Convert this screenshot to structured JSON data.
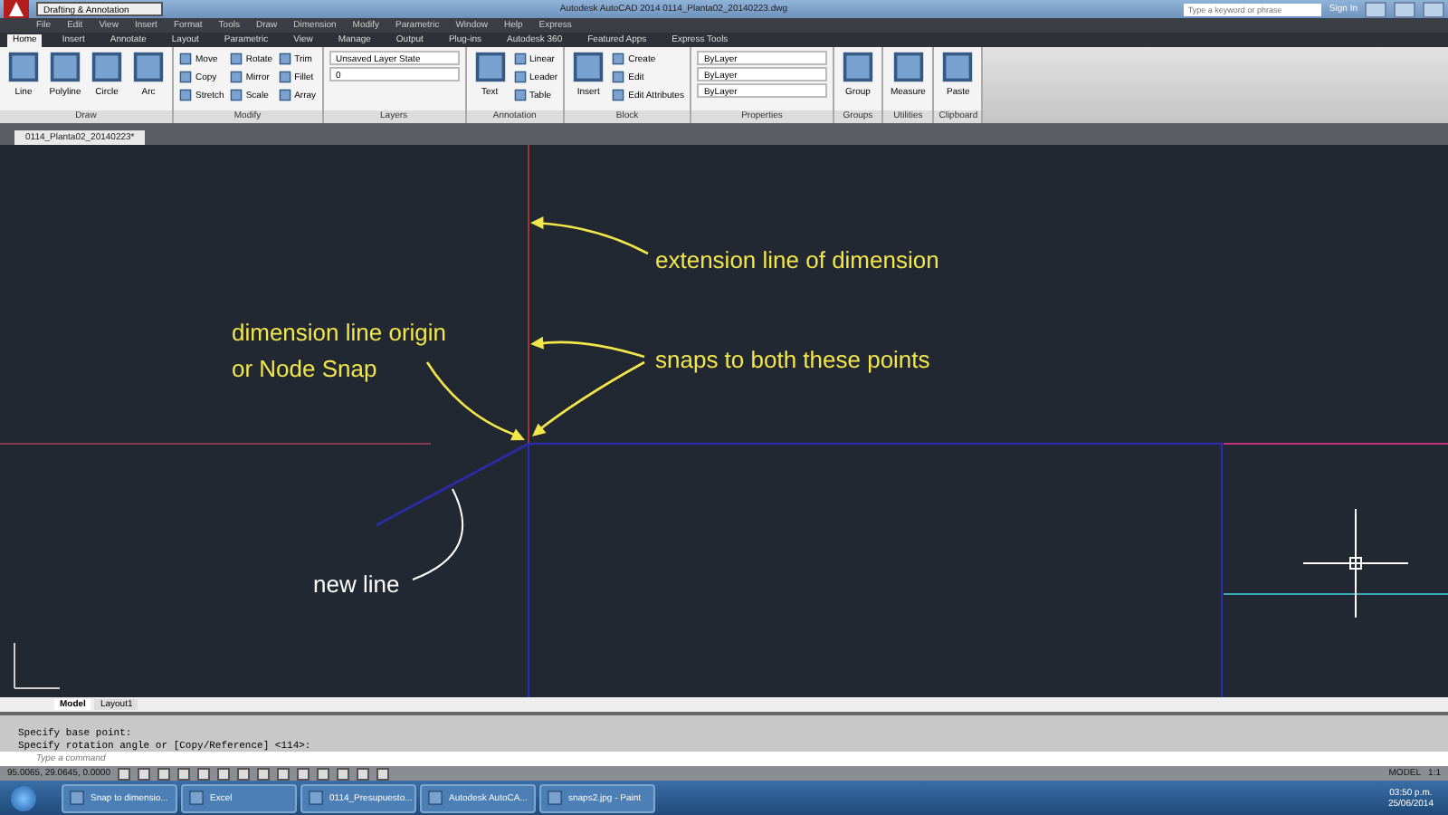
{
  "title_bar": {
    "workspace": "Drafting & Annotation",
    "title": "Autodesk AutoCAD 2014   0114_Planta02_20140223.dwg",
    "search_placeholder": "Type a keyword or phrase",
    "sign_in": "Sign In"
  },
  "menu_bar": [
    "File",
    "Edit",
    "View",
    "Insert",
    "Format",
    "Tools",
    "Draw",
    "Dimension",
    "Modify",
    "Parametric",
    "Window",
    "Help",
    "Express"
  ],
  "ribbon_tabs": [
    {
      "label": "Home",
      "selected": true
    },
    {
      "label": "Insert",
      "selected": false
    },
    {
      "label": "Annotate",
      "selected": false
    },
    {
      "label": "Layout",
      "selected": false
    },
    {
      "label": "Parametric",
      "selected": false
    },
    {
      "label": "View",
      "selected": false
    },
    {
      "label": "Manage",
      "selected": false
    },
    {
      "label": "Output",
      "selected": false
    },
    {
      "label": "Plug-ins",
      "selected": false
    },
    {
      "label": "Autodesk 360",
      "selected": false
    },
    {
      "label": "Featured Apps",
      "selected": false
    },
    {
      "label": "Express Tools",
      "selected": false
    }
  ],
  "ribbon_panels": [
    {
      "title": "Draw",
      "tools": [
        {
          "label": "Line",
          "kind": "large"
        },
        {
          "label": "Polyline",
          "kind": "large"
        },
        {
          "label": "Circle",
          "kind": "large"
        },
        {
          "label": "Arc",
          "kind": "large"
        }
      ]
    },
    {
      "title": "Modify",
      "tools": [
        {
          "label": "Move",
          "kind": "small"
        },
        {
          "label": "Copy",
          "kind": "small"
        },
        {
          "label": "Stretch",
          "kind": "small"
        },
        {
          "label": "Rotate",
          "kind": "small"
        },
        {
          "label": "Mirror",
          "kind": "small"
        },
        {
          "label": "Scale",
          "kind": "small"
        },
        {
          "label": "Trim",
          "kind": "small"
        },
        {
          "label": "Fillet",
          "kind": "small"
        },
        {
          "label": "Array",
          "kind": "small"
        }
      ]
    },
    {
      "title": "Layers",
      "tools": [
        {
          "label": "Unsaved Layer State",
          "kind": "dropdown"
        },
        {
          "label": "0",
          "kind": "dropdown"
        }
      ]
    },
    {
      "title": "Annotation",
      "tools": [
        {
          "label": "Text",
          "kind": "large"
        },
        {
          "label": "Linear",
          "kind": "small"
        },
        {
          "label": "Leader",
          "kind": "small"
        },
        {
          "label": "Table",
          "kind": "small"
        }
      ]
    },
    {
      "title": "Block",
      "tools": [
        {
          "label": "Insert",
          "kind": "large"
        },
        {
          "label": "Create",
          "kind": "small"
        },
        {
          "label": "Edit",
          "kind": "small"
        },
        {
          "label": "Edit Attributes",
          "kind": "small"
        }
      ]
    },
    {
      "title": "Properties",
      "tools": [
        {
          "label": "ByLayer",
          "kind": "dropdown"
        },
        {
          "label": "ByLayer",
          "kind": "dropdown"
        },
        {
          "label": "ByLayer",
          "kind": "dropdown"
        }
      ]
    },
    {
      "title": "Groups",
      "tools": [
        {
          "label": "Group",
          "kind": "large"
        }
      ]
    },
    {
      "title": "Utilities",
      "tools": [
        {
          "label": "Measure",
          "kind": "large"
        }
      ]
    },
    {
      "title": "Clipboard",
      "tools": [
        {
          "label": "Paste",
          "kind": "large"
        }
      ]
    }
  ],
  "document_tabs": [
    {
      "label": "0114_Planta02_20140223*",
      "selected": true
    }
  ],
  "canvas": {
    "annotations": [
      {
        "text": "extension line of dimension",
        "color": "#f2e64a"
      },
      {
        "text": "dimension line origin",
        "color": "#f2e64a"
      },
      {
        "text": "or Node Snap",
        "color": "#f2e64a"
      },
      {
        "text": "snaps to both these points",
        "color": "#f2e64a"
      },
      {
        "text": "new line",
        "color": "#ffffff"
      }
    ]
  },
  "layout_tabs": [
    {
      "label": "Model",
      "selected": true
    },
    {
      "label": "Layout1",
      "selected": false
    }
  ],
  "command_line": {
    "history": [
      "Specify base point:",
      "Specify rotation angle or [Copy/Reference] <114>:"
    ],
    "placeholder": "Type a command"
  },
  "status_bar": {
    "coordinates": "95.0065, 29.0645, 0.0000",
    "space": "MODEL",
    "scale": "1:1"
  },
  "taskbar": {
    "items": [
      "Snap to dimensio...",
      "Excel",
      "0114_Presupuesto...",
      "Autodesk AutoCA...",
      "snaps2.jpg - Paint"
    ],
    "time": "03:50 p.m.",
    "date": "25/06/2014"
  }
}
